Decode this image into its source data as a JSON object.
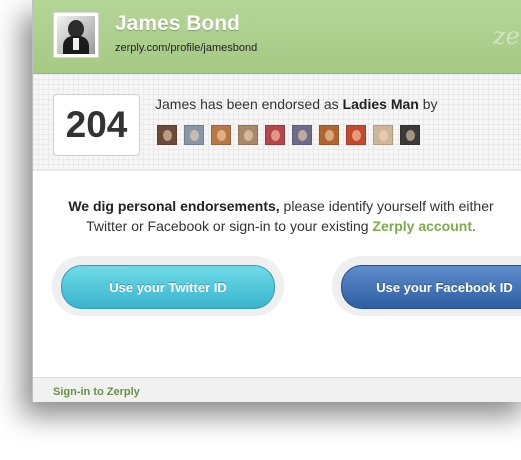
{
  "profile": {
    "name": "James Bond",
    "url": "zerply.com/profile/jamesbond",
    "watermark": "ze"
  },
  "endorsement": {
    "count": "204",
    "text_prefix": "James has been endorsed as ",
    "title": "Ladies Man",
    "text_suffix": " by",
    "endorsers": [
      {
        "color": "#6b4a3a"
      },
      {
        "color": "#8a95a6"
      },
      {
        "color": "#b87845"
      },
      {
        "color": "#a88a6a"
      },
      {
        "color": "#b8444c"
      },
      {
        "color": "#6d6d8a"
      },
      {
        "color": "#b0672f"
      },
      {
        "color": "#c24a30"
      },
      {
        "color": "#cdb79a"
      },
      {
        "color": "#3a3a3a"
      }
    ]
  },
  "message": {
    "bold": "We dig personal endorsements,",
    "rest_line1": " please identify yourself with either",
    "line2": "Twitter or Facebook or sign-in to your existing ",
    "link": "Zerply account",
    "period": "."
  },
  "buttons": {
    "twitter_label": "Use your Twitter ID",
    "facebook_label": "Use your Facebook ID"
  },
  "footer": {
    "signin_label": "Sign-in to Zerply"
  },
  "colors": {
    "header_green": "#a6c985",
    "link_green": "#7bab4b",
    "twitter_blue": "#3ab3cd",
    "facebook_blue": "#2e5ea3"
  }
}
